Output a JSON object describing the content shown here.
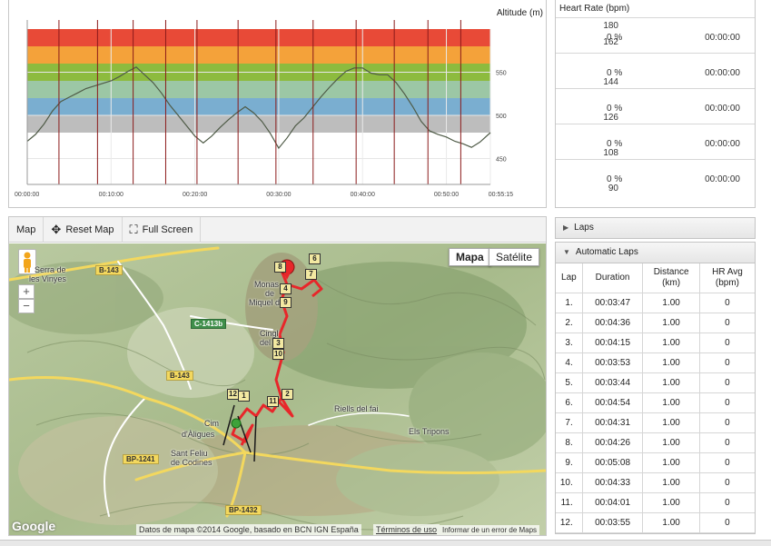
{
  "chart_data": {
    "type": "area",
    "title": "",
    "ylabel": "Altitude (m)",
    "xlabel": "",
    "y_ticks": [
      "550",
      "500",
      "450"
    ],
    "y_tick_values": [
      550,
      500,
      450
    ],
    "ylim": [
      420,
      600
    ],
    "x_ticks": [
      "00:00:00",
      "00:10:00",
      "00:20:00",
      "00:30:00",
      "00:40:00",
      "00:50:00",
      "00:55:15"
    ],
    "x_tick_values": [
      0,
      600,
      1200,
      1800,
      2400,
      3000,
      3315
    ],
    "xlim": [
      0,
      3315
    ],
    "zones": [
      {
        "from": 580,
        "to": 600,
        "color": "#e84a37"
      },
      {
        "from": 560,
        "to": 580,
        "color": "#f4a23a"
      },
      {
        "from": 540,
        "to": 560,
        "color": "#8dbb3e"
      },
      {
        "from": 520,
        "to": 540,
        "color": "#9cc7a5"
      },
      {
        "from": 500,
        "to": 520,
        "color": "#7aaed0"
      },
      {
        "from": 480,
        "to": 500,
        "color": "#bdbdbd"
      }
    ],
    "lap_lines_t": [
      227,
      503,
      758,
      991,
      1215,
      1509,
      1780,
      2046,
      2354,
      2627,
      2868,
      3103
    ],
    "x": [
      0,
      60,
      120,
      180,
      240,
      300,
      360,
      420,
      480,
      540,
      600,
      660,
      720,
      780,
      840,
      900,
      960,
      1020,
      1080,
      1140,
      1200,
      1260,
      1320,
      1380,
      1440,
      1500,
      1560,
      1620,
      1680,
      1740,
      1800,
      1860,
      1920,
      1980,
      2040,
      2100,
      2160,
      2220,
      2280,
      2340,
      2400,
      2460,
      2520,
      2580,
      2640,
      2700,
      2760,
      2820,
      2880,
      2940,
      3000,
      3060,
      3120,
      3180,
      3240,
      3315
    ],
    "altitude": [
      470,
      478,
      490,
      505,
      516,
      521,
      526,
      531,
      534,
      537,
      540,
      545,
      551,
      556,
      547,
      538,
      526,
      512,
      500,
      488,
      476,
      468,
      476,
      486,
      495,
      503,
      510,
      503,
      493,
      479,
      462,
      474,
      488,
      497,
      509,
      521,
      532,
      542,
      551,
      555,
      555,
      549,
      547,
      547,
      538,
      525,
      510,
      493,
      482,
      478,
      475,
      470,
      467,
      463,
      469,
      480
    ]
  },
  "heart_rate": {
    "title": "Heart Rate (bpm)",
    "rows": [
      {
        "bpm_top": "180",
        "bpm_bottom": "162",
        "pct": "0 %",
        "time": "00:00:00"
      },
      {
        "bpm_top": "",
        "bpm_bottom": "144",
        "pct": "0 %",
        "time": "00:00:00"
      },
      {
        "bpm_top": "",
        "bpm_bottom": "126",
        "pct": "0 %",
        "time": "00:00:00"
      },
      {
        "bpm_top": "",
        "bpm_bottom": "108",
        "pct": "0 %",
        "time": "00:00:00"
      },
      {
        "bpm_top": "",
        "bpm_bottom": "90",
        "pct": "0 %",
        "time": "00:00:00"
      }
    ]
  },
  "map": {
    "toolbar": {
      "map_label": "Map",
      "reset_label": "Reset Map",
      "fullscreen_label": "Full Screen"
    },
    "type_map": "Mapa",
    "type_satellite": "Satélite",
    "zoom_in": "+",
    "zoom_out": "−",
    "attribution": "Datos de mapa ©2014 Google, basado en BCN IGN España",
    "terms": "Términos de uso",
    "report": "Informar de un error de Maps",
    "logo": "Google",
    "labels": {
      "serra": "Serra de",
      "vinyes": "les Vinyes",
      "monastir": "Monas",
      "monastir2": "de",
      "miquel": "Miquel d",
      "cingles": "Cingl",
      "cingles2": "del F",
      "riells": "Riells del fai",
      "tripons": "Els Tripons",
      "cim": "Cim",
      "aligues": "d'Àligues",
      "sant_feliu": "Sant Feliu",
      "codines": "de Codines"
    },
    "roads": {
      "b143a": "B-143",
      "c1413b": "C-1413b",
      "b143b": "B-143",
      "bp1241": "BP-1241",
      "bp1432": "BP-1432"
    },
    "lap_markers": [
      "6",
      "7",
      "8",
      "4",
      "9",
      "3",
      "10",
      "1",
      "12",
      "11",
      "2"
    ],
    "colors": {
      "route": "#e8262a",
      "marker_fill": "#f3e9a2"
    }
  },
  "laps": {
    "collapsed_header": "Laps",
    "header": "Automatic Laps",
    "columns": [
      "Lap",
      "Duration",
      "Distance (km)",
      "HR Avg (bpm)"
    ],
    "rows": [
      [
        "1.",
        "00:03:47",
        "1.00",
        "0"
      ],
      [
        "2.",
        "00:04:36",
        "1.00",
        "0"
      ],
      [
        "3.",
        "00:04:15",
        "1.00",
        "0"
      ],
      [
        "4.",
        "00:03:53",
        "1.00",
        "0"
      ],
      [
        "5.",
        "00:03:44",
        "1.00",
        "0"
      ],
      [
        "6.",
        "00:04:54",
        "1.00",
        "0"
      ],
      [
        "7.",
        "00:04:31",
        "1.00",
        "0"
      ],
      [
        "8.",
        "00:04:26",
        "1.00",
        "0"
      ],
      [
        "9.",
        "00:05:08",
        "1.00",
        "0"
      ],
      [
        "10.",
        "00:04:33",
        "1.00",
        "0"
      ],
      [
        "11.",
        "00:04:01",
        "1.00",
        "0"
      ],
      [
        "12.",
        "00:03:55",
        "1.00",
        "0"
      ]
    ]
  }
}
